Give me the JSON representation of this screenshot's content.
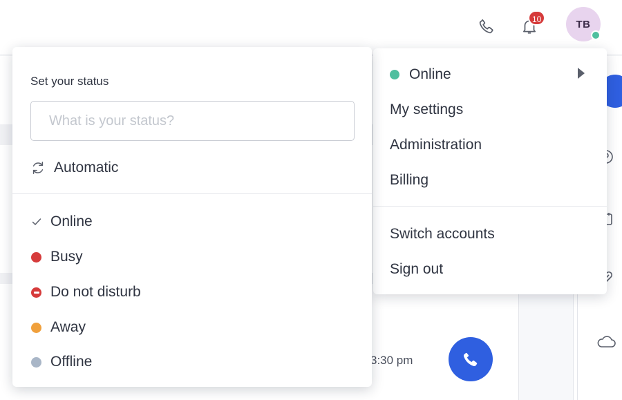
{
  "topbar": {
    "notifications_count": "10",
    "avatar_initials": "TB",
    "colors": {
      "avatar_bg": "#e8d4ee",
      "presence": "#4fbf9f",
      "badge": "#d63b3b"
    }
  },
  "background": {
    "call_time": "3:30 pm"
  },
  "account_menu": {
    "current_status": "Online",
    "items": [
      {
        "label": "My settings"
      },
      {
        "label": "Administration"
      },
      {
        "label": "Billing"
      }
    ],
    "secondary_items": [
      {
        "label": "Switch accounts"
      },
      {
        "label": "Sign out"
      }
    ]
  },
  "status_menu": {
    "title": "Set your status",
    "input_placeholder": "What is your status?",
    "input_value": "",
    "automatic_label": "Automatic",
    "options": [
      {
        "label": "Online",
        "indicator": "check-icon",
        "selected": true
      },
      {
        "label": "Busy",
        "indicator": "dot",
        "color": "#d63b3b"
      },
      {
        "label": "Do not disturb",
        "indicator": "dnd-icon",
        "color": "#d63b3b"
      },
      {
        "label": "Away",
        "indicator": "dot",
        "color": "#f0a03c"
      },
      {
        "label": "Offline",
        "indicator": "dot",
        "color": "#a9b6c7"
      }
    ]
  }
}
